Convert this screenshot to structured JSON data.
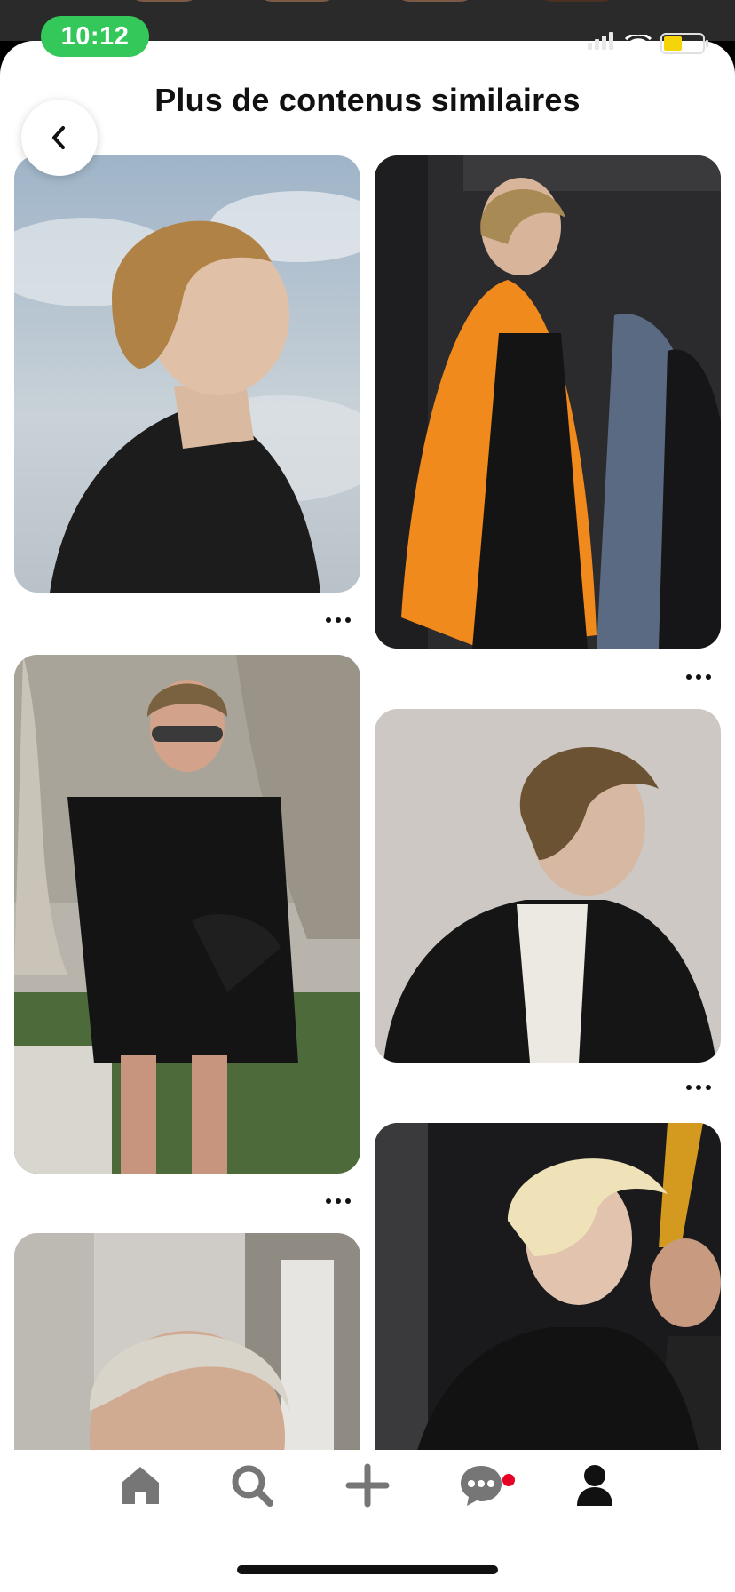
{
  "status_bar": {
    "time": "10:12"
  },
  "header": {
    "title": "Plus de contenus similaires"
  },
  "pins": [
    {
      "id": "pin-1",
      "subject": "short-haired woman in black leather jacket against sky"
    },
    {
      "id": "pin-2",
      "subject": "woman in orange blazer walking"
    },
    {
      "id": "pin-3",
      "subject": "woman with sunglasses in black t-shirt dress"
    },
    {
      "id": "pin-4",
      "subject": "woman with short hair in black blazer"
    },
    {
      "id": "pin-5",
      "subject": "blonde short-haired woman in black suit"
    },
    {
      "id": "pin-6",
      "subject": "blonde short hair portrait"
    }
  ],
  "nav": {
    "items": [
      "home-icon",
      "search-icon",
      "plus-icon",
      "messages-icon",
      "profile-icon"
    ],
    "notification_color": "#e60023"
  },
  "colors": {
    "accent": "#e60023",
    "status_pill": "#34c759"
  }
}
